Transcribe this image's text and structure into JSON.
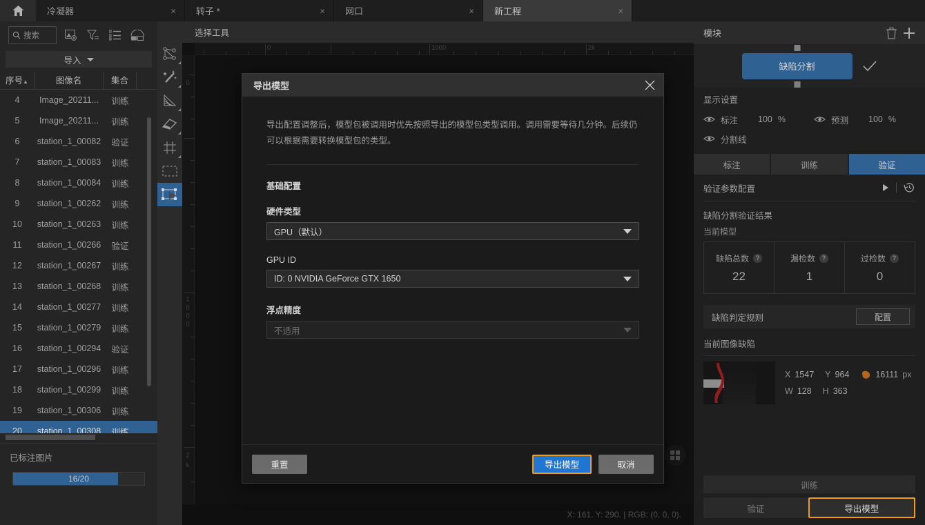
{
  "tabs": {
    "home_icon": "home-icon",
    "items": [
      {
        "label": "冷凝器",
        "close": "×",
        "active": false
      },
      {
        "label": "转子 *",
        "close": "×",
        "active": false
      },
      {
        "label": "网口",
        "close": "×",
        "active": false
      },
      {
        "label": "新工程",
        "close": "×",
        "active": true
      }
    ]
  },
  "sidebar": {
    "search": {
      "placeholder": "搜索",
      "icon": "search-icon"
    },
    "toolbar_icons": [
      "image-settings-icon",
      "filter-icon",
      "list-icon",
      "shapes-icon"
    ],
    "import_label": "导入",
    "columns": [
      "序号",
      "图像名",
      "集合"
    ],
    "rows": [
      {
        "no": "4",
        "name": "Image_20211...",
        "set": "训练"
      },
      {
        "no": "5",
        "name": "Image_20211...",
        "set": "训练"
      },
      {
        "no": "6",
        "name": "station_1_00082",
        "set": "验证"
      },
      {
        "no": "7",
        "name": "station_1_00083",
        "set": "训练"
      },
      {
        "no": "8",
        "name": "station_1_00084",
        "set": "训练"
      },
      {
        "no": "9",
        "name": "station_1_00262",
        "set": "训练"
      },
      {
        "no": "10",
        "name": "station_1_00263",
        "set": "训练"
      },
      {
        "no": "11",
        "name": "station_1_00266",
        "set": "验证"
      },
      {
        "no": "12",
        "name": "station_1_00267",
        "set": "训练"
      },
      {
        "no": "13",
        "name": "station_1_00268",
        "set": "训练"
      },
      {
        "no": "14",
        "name": "station_1_00277",
        "set": "训练"
      },
      {
        "no": "15",
        "name": "station_1_00279",
        "set": "训练"
      },
      {
        "no": "16",
        "name": "station_1_00294",
        "set": "验证"
      },
      {
        "no": "17",
        "name": "station_1_00296",
        "set": "训练"
      },
      {
        "no": "18",
        "name": "station_1_00299",
        "set": "训练"
      },
      {
        "no": "19",
        "name": "station_1_00306",
        "set": "训练"
      },
      {
        "no": "20",
        "name": "station_1_00308",
        "set": "训练"
      }
    ],
    "selected_row_index": 16,
    "labeled_title": "已标注图片",
    "progress": {
      "label": "16/20",
      "percent": 80,
      "color": "#2f6193"
    }
  },
  "tools": [
    {
      "name": "polygon-tool"
    },
    {
      "name": "magic-wand-tool"
    },
    {
      "name": "gradient-tool"
    },
    {
      "name": "eraser-tool"
    },
    {
      "name": "grid-tool"
    },
    {
      "name": "marquee-tool"
    },
    {
      "name": "select-transform-tool",
      "active": true
    }
  ],
  "canvas": {
    "toolbar_label": "选择工具",
    "ruler_h_labels": [
      "0",
      "1000",
      "2k"
    ],
    "ruler_v_labels": [
      "0",
      "1000",
      "2k"
    ],
    "status": "X: 161. Y: 290. | RGB: (0, 0, 0)."
  },
  "right_panel": {
    "header": {
      "title": "模块",
      "delete_icon": "trash-icon",
      "add_icon": "plus-icon"
    },
    "module_node": {
      "label": "缺陷分割",
      "check_icon": "check-icon",
      "color": "#2f6193"
    },
    "display_settings": {
      "title": "显示设置",
      "rows": [
        {
          "icon": "eye-icon",
          "label": "标注",
          "value": "100",
          "unit": "%"
        },
        {
          "icon": "eye-icon",
          "label": "预测",
          "value": "100",
          "unit": "%"
        },
        {
          "icon": "eye-icon",
          "label": "分割线",
          "value": "",
          "unit": ""
        }
      ]
    },
    "tabs": [
      {
        "label": "标注",
        "active": false
      },
      {
        "label": "训练",
        "active": false
      },
      {
        "label": "验证",
        "active": true
      }
    ],
    "param_row": {
      "label": "验证参数配置",
      "play_icon": "play-icon",
      "history_icon": "history-icon"
    },
    "result_title": "缺陷分割验证结果",
    "result_sub": "当前模型",
    "metrics": [
      {
        "label": "缺陷总数",
        "help": "?",
        "value": "22"
      },
      {
        "label": "漏检数",
        "help": "?",
        "value": "1"
      },
      {
        "label": "过检数",
        "help": "?",
        "value": "0"
      }
    ],
    "rule_bar": {
      "label": "缺陷判定规则",
      "button": "配置"
    },
    "current_defect_title": "当前图像缺陷",
    "defect": {
      "x_key": "X",
      "x_val": "1547",
      "y_key": "Y",
      "y_val": "964",
      "area_icon": "blob-icon",
      "area_val": "16111",
      "area_unit": "px",
      "w_key": "W",
      "w_val": "128",
      "h_key": "H",
      "h_val": "363"
    },
    "actions": {
      "train": "训练",
      "validate": "验证",
      "export": "导出模型",
      "highlight_color": "#f39c12"
    }
  },
  "modal": {
    "title": "导出模型",
    "close_icon": "close-icon",
    "description": "导出配置调整后，模型包被调用时优先按照导出的模型包类型调用。调用需要等待几分钟。后续仍可以根据需要转换模型包的类型。",
    "section": "基础配置",
    "fields": [
      {
        "label": "硬件类型",
        "value": "GPU（默认）",
        "disabled": false
      },
      {
        "label": "GPU ID",
        "value": "ID: 0  NVIDIA GeForce GTX 1650",
        "disabled": false
      },
      {
        "label": "浮点精度",
        "value": "不适用",
        "disabled": true
      }
    ],
    "buttons": {
      "reset": "重置",
      "export": "导出模型",
      "cancel": "取消",
      "export_accent": "#f39c12",
      "export_bg": "#2176d2"
    }
  }
}
